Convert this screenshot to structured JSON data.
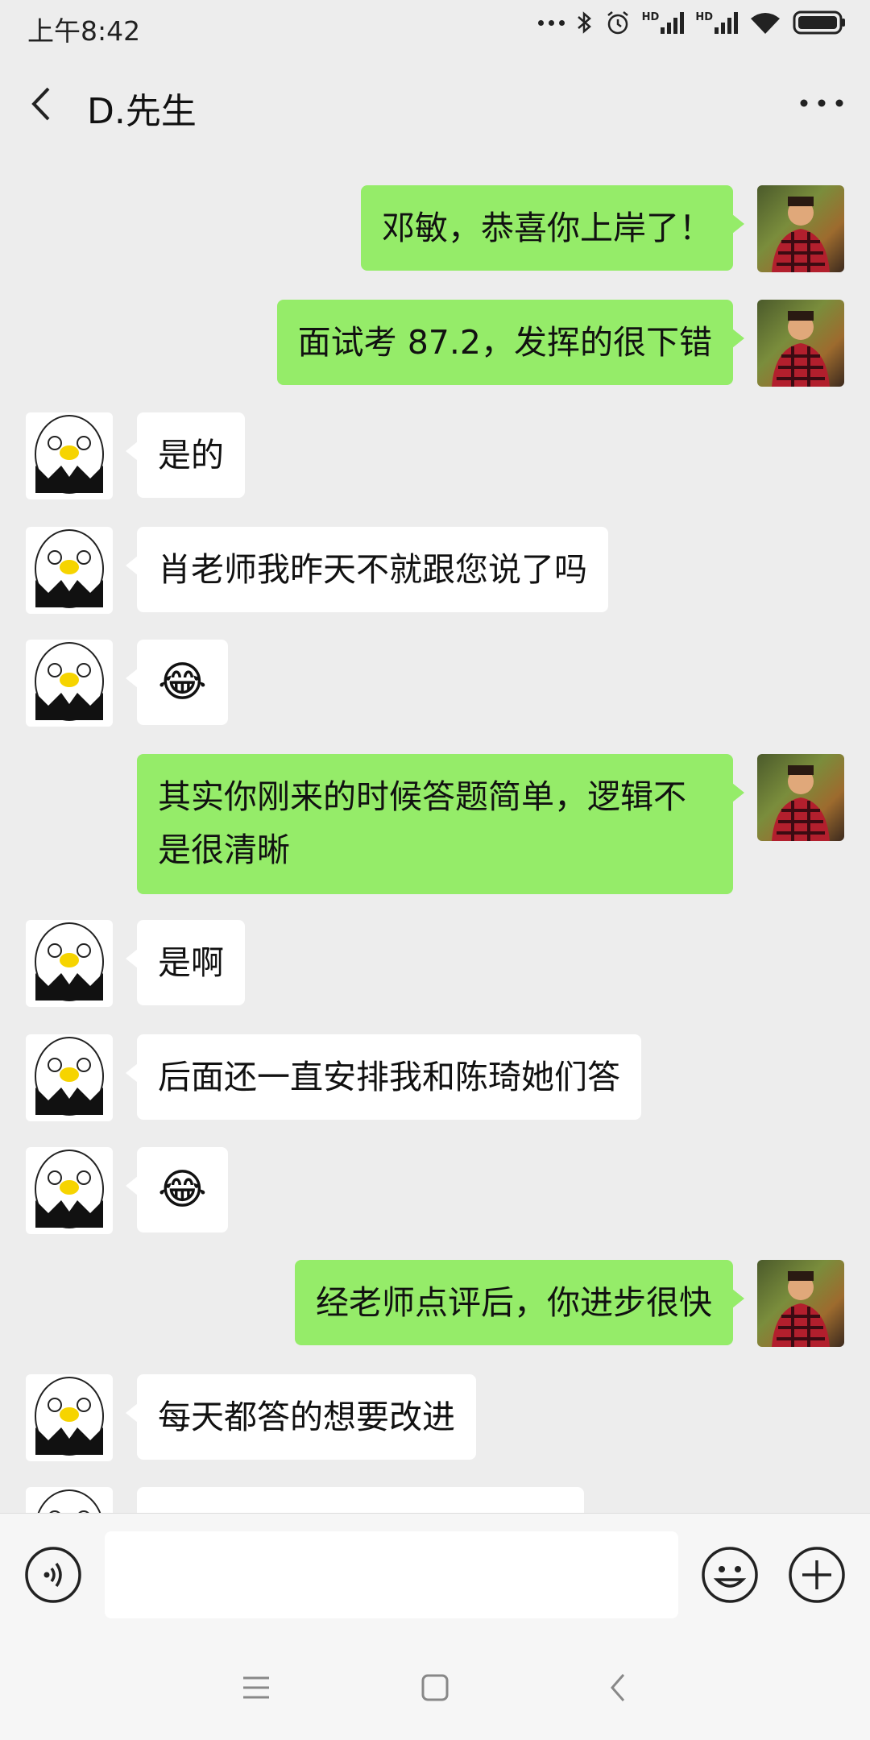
{
  "status_bar": {
    "time": "上午8:42",
    "icons": [
      "more-dots-icon",
      "bluetooth-icon",
      "alarm-icon",
      "hd-signal-icon",
      "hd-signal-icon",
      "wifi-icon",
      "battery-icon"
    ],
    "hd_label": "HD"
  },
  "header": {
    "title": "D.先生",
    "back_icon": "chevron-left-icon",
    "more_icon": "more-horizontal-icon"
  },
  "messages": [
    {
      "from": "me",
      "text": "邓敏，恭喜你上岸了！"
    },
    {
      "from": "me",
      "text": "面试考 87.2，发挥的很下错"
    },
    {
      "from": "peer",
      "text": "是的"
    },
    {
      "from": "peer",
      "text": "肖老师我昨天不就跟您说了吗"
    },
    {
      "from": "peer",
      "text": "😂"
    },
    {
      "from": "me",
      "text": "其实你刚来的时候答题简单，逻辑不是很清晰"
    },
    {
      "from": "peer",
      "text": "是啊"
    },
    {
      "from": "peer",
      "text": "后面还一直安排我和陈琦她们答"
    },
    {
      "from": "peer",
      "text": "😂"
    },
    {
      "from": "me",
      "text": "经老师点评后，你进步很快"
    },
    {
      "from": "peer",
      "text": "每天都答的想要改进"
    }
  ],
  "input_bar": {
    "voice_icon": "voice-icon",
    "text_value": "",
    "emoji_icon": "smiley-icon",
    "add_icon": "plus-icon"
  },
  "nav_keys": [
    "menu-icon",
    "home-icon",
    "back-icon"
  ],
  "colors": {
    "my_bubble": "#95ec69",
    "peer_bubble": "#ffffff",
    "background": "#ededed"
  }
}
